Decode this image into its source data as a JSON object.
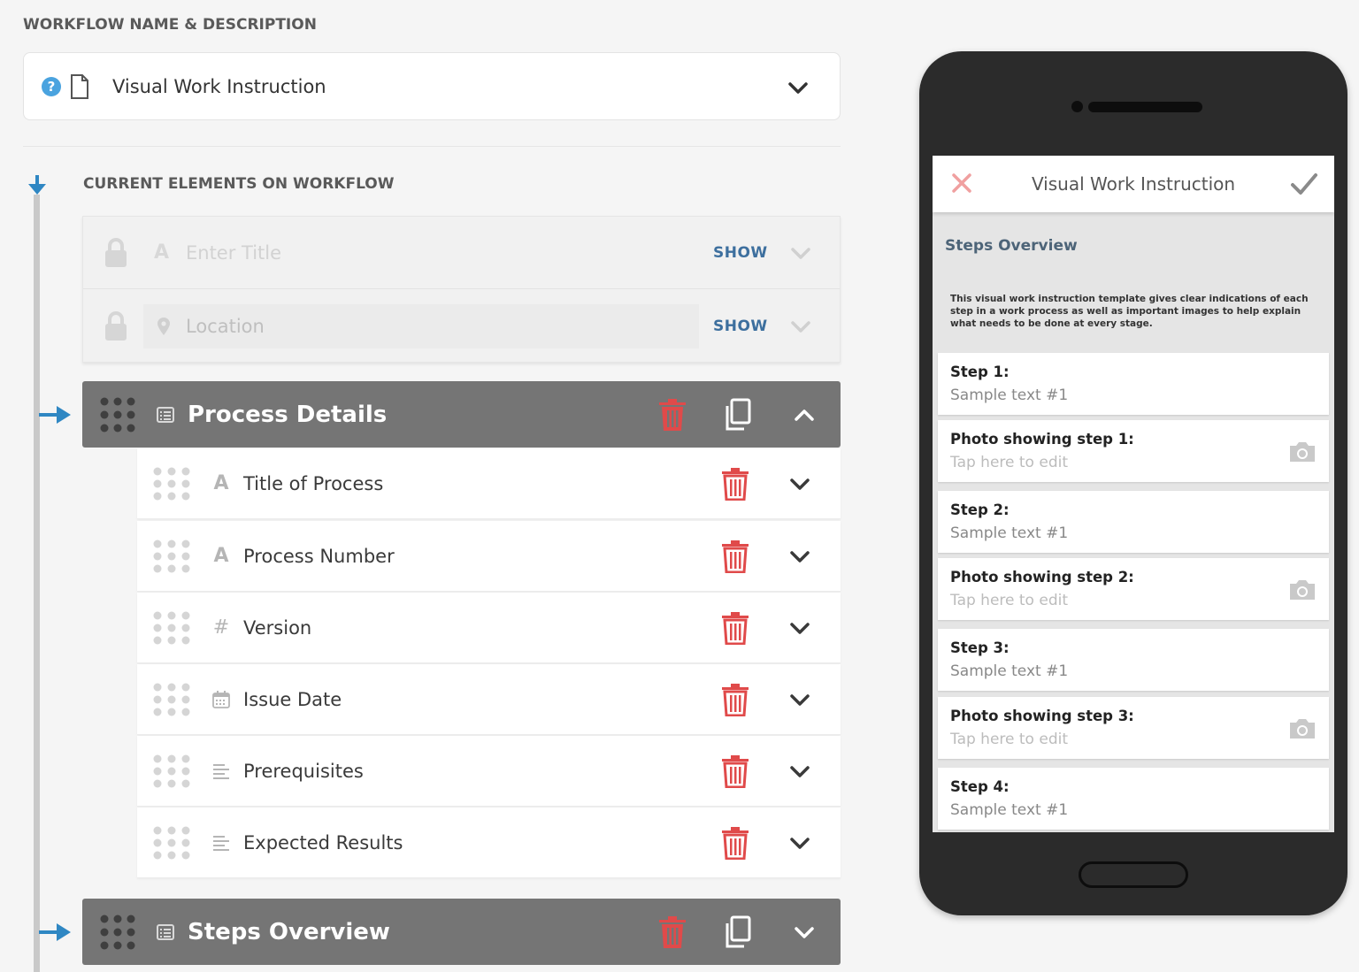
{
  "workflow": {
    "section_label": "WORKFLOW NAME & DESCRIPTION",
    "name": "Visual Work Instruction"
  },
  "current": {
    "section_label": "CURRENT ELEMENTS ON WORKFLOW",
    "locked": [
      {
        "placeholder": "Enter Title",
        "show_label": "SHOW"
      },
      {
        "placeholder": "Location",
        "show_label": "SHOW"
      }
    ],
    "sections": [
      {
        "title": "Process Details",
        "expanded": true,
        "items": [
          {
            "label": "Title of Process",
            "icon": "text-icon"
          },
          {
            "label": "Process Number",
            "icon": "text-icon"
          },
          {
            "label": "Version",
            "icon": "number-icon"
          },
          {
            "label": "Issue Date",
            "icon": "calendar-icon"
          },
          {
            "label": "Prerequisites",
            "icon": "paragraph-icon"
          },
          {
            "label": "Expected Results",
            "icon": "paragraph-icon"
          }
        ]
      },
      {
        "title": "Steps Overview",
        "expanded": false,
        "items": []
      }
    ]
  },
  "preview": {
    "title": "Visual Work Instruction",
    "section_heading": "Steps Overview",
    "description": "This visual work instruction template gives clear indications of each step in a work process as well as important images to help explain what needs to be done at every stage.",
    "cards": [
      {
        "title": "Step 1:",
        "value": "Sample text #1",
        "photo": false
      },
      {
        "title": "Photo showing step 1:",
        "value": "Tap here to edit",
        "photo": true
      },
      {
        "title": "Step 2:",
        "value": "Sample text #1",
        "photo": false
      },
      {
        "title": "Photo showing step 2:",
        "value": "Tap here to edit",
        "photo": true
      },
      {
        "title": "Step 3:",
        "value": "Sample text #1",
        "photo": false
      },
      {
        "title": "Photo showing step 3:",
        "value": "Tap here to edit",
        "photo": true
      },
      {
        "title": "Step 4:",
        "value": "Sample text #1",
        "photo": false
      }
    ]
  },
  "colors": {
    "accent_blue": "#2f87c3",
    "delete_red": "#e04a4a",
    "section_header": "#757575",
    "link_blue": "#3d6f9e"
  }
}
